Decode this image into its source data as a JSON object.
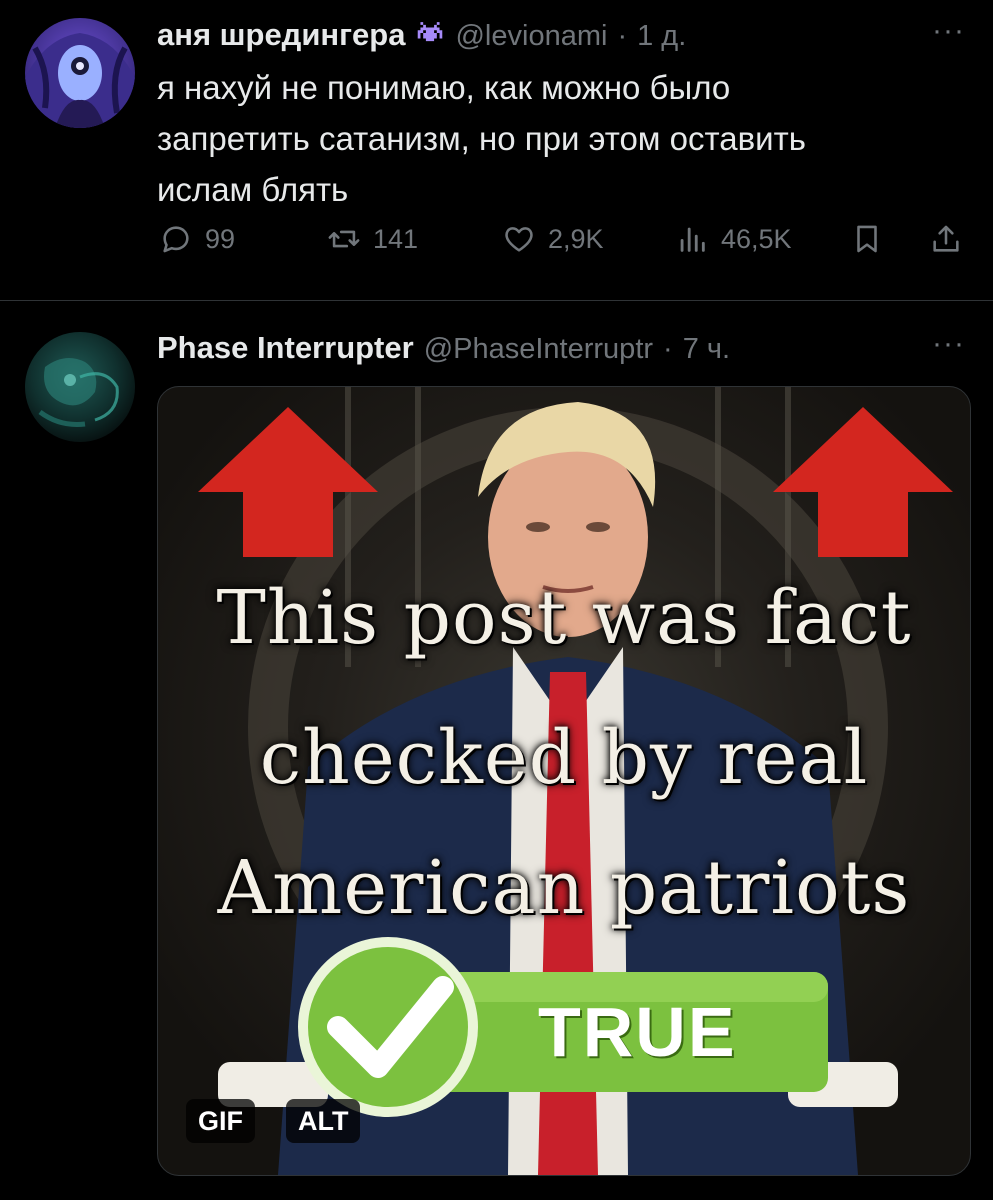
{
  "tweet1": {
    "name": "аня шредингера",
    "badge_icon": "space-invader-icon",
    "handle": "@levionami",
    "time": "1 д.",
    "text_lines": [
      "я нахуй не понимаю, как можно было",
      "запретить сатанизм, но при этом оставить",
      "ислам блять"
    ],
    "stats": {
      "replies": "99",
      "retweets": "141",
      "likes": "2,9K",
      "views": "46,5K"
    }
  },
  "tweet2": {
    "name": "Phase Interrupter",
    "handle": "@PhaseInterruptr",
    "time": "7 ч.",
    "media": {
      "caption_lines": [
        "This post was fact",
        "checked by real",
        "American patriots"
      ],
      "check_label": "TRUE",
      "gif_badge": "GIF",
      "alt_badge": "ALT"
    }
  },
  "more_label": "···",
  "colors": {
    "background": "#000000",
    "text": "#e7e9ea",
    "muted": "#71767b",
    "divider": "#2f3336",
    "arrow_red": "#d3261f",
    "check_green": "#7cc13f"
  }
}
